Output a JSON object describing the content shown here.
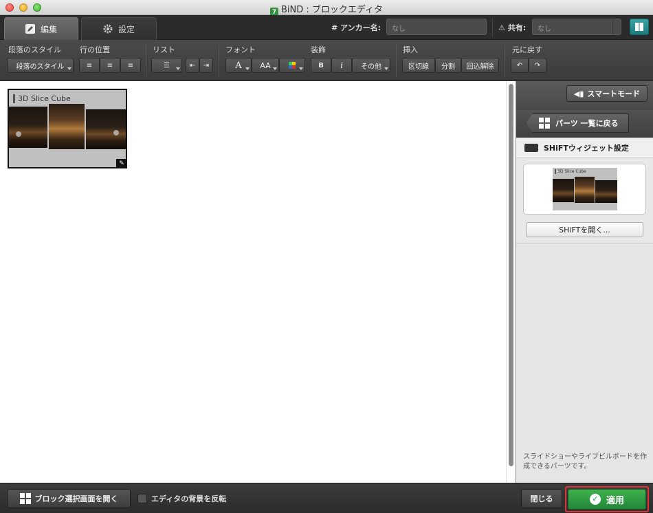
{
  "window": {
    "title": "BiND : ブロックエディタ",
    "app_icon_glyph": "7"
  },
  "tabs": [
    {
      "label": "編集",
      "icon": "pencil-icon"
    },
    {
      "label": "設定",
      "icon": "gear-icon"
    }
  ],
  "anchor": {
    "label": "# アンカー名:",
    "placeholder": "なし"
  },
  "share": {
    "label": "共有:",
    "value": "なし"
  },
  "toolbar": {
    "paragraph_style": {
      "label": "段落のスタイル",
      "button": "段落のスタイル"
    },
    "line_position": {
      "label": "行の位置"
    },
    "list": {
      "label": "リスト"
    },
    "font": {
      "label": "フォント",
      "btn_a": "A",
      "btn_aa": "AA"
    },
    "decoration": {
      "label": "装飾",
      "bold": "B",
      "italic": "i",
      "other": "その他"
    },
    "insert": {
      "label": "挿入",
      "divider": "区切線",
      "split": "分割",
      "unwrap": "回込解除"
    },
    "undo": {
      "label": "元に戻す"
    }
  },
  "widget": {
    "label": "3D Slice Cube"
  },
  "right_panel": {
    "smart_mode": "スマートモード",
    "back_to_parts": "パーツ 一覧に戻る",
    "heading": "SHiFTウィジェット設定",
    "thumb_label": "3D Slice Cube",
    "open_button": "SHiFTを開く...",
    "description": "スライドショーやライブビルボードを作成できるパーツです。"
  },
  "bottom": {
    "open_block_select": "ブロック選択画面を開く",
    "invert_bg": "エディタの背景を反転",
    "close": "閉じる",
    "apply": "適用"
  },
  "colors": {
    "apply_green": "#2f9e44",
    "accent_red": "#d33333",
    "bg_dark": "#3a3a3a"
  }
}
